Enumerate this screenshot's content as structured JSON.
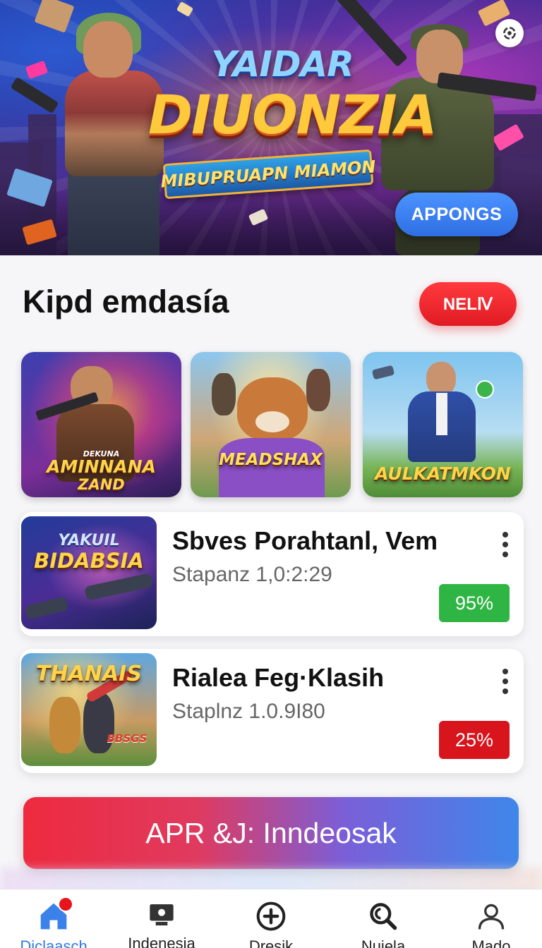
{
  "hero": {
    "title_line1": "YAIDAR",
    "title_line2": "DIUONZIA",
    "ribbon": "MIBUPRUAPN MIAMON",
    "cta_label": "APPONGS"
  },
  "section": {
    "title": "Kipd emdasía",
    "badge_label": "NELⅣ"
  },
  "tiles": [
    {
      "label_small": "DEKUNA",
      "label_line1": "AMINNANA",
      "label_line2": "ZAND"
    },
    {
      "label_small": "",
      "label_line1": "MEADSHAX",
      "label_line2": ""
    },
    {
      "label_small": "",
      "label_line1": "AULKATMKON",
      "label_line2": ""
    }
  ],
  "cards": [
    {
      "thumb_line1": "YAKUIL",
      "thumb_line2": "BIDABSIA",
      "title": "Sbves Porahtanl, Vem",
      "subtitle": "Stapanz 1,0:2:29",
      "percent": "95%",
      "percent_color": "#2fb543"
    },
    {
      "thumb_line1": "THANAIS",
      "thumb_line2": "BBSGS",
      "title": "Rialea Feg·Klasih",
      "subtitle": "Staplnz 1.0.9I80",
      "percent": "25%",
      "percent_color": "#d8141c"
    }
  ],
  "cta": {
    "label": "APR &J: Inndeosak"
  },
  "nav": [
    {
      "label": "Diclaasch",
      "icon": "home-icon",
      "active": true
    },
    {
      "label": "Indenesia",
      "icon": "display-icon",
      "active": false
    },
    {
      "label": "Dresik",
      "icon": "plus-circle-icon",
      "active": false
    },
    {
      "label": "Nuiela",
      "icon": "search-icon",
      "active": false
    },
    {
      "label": "Mado",
      "icon": "profile-icon",
      "active": false
    }
  ],
  "colors": {
    "accent_blue": "#2f7be6",
    "badge_red": "#e01b22",
    "green": "#2fb543"
  }
}
